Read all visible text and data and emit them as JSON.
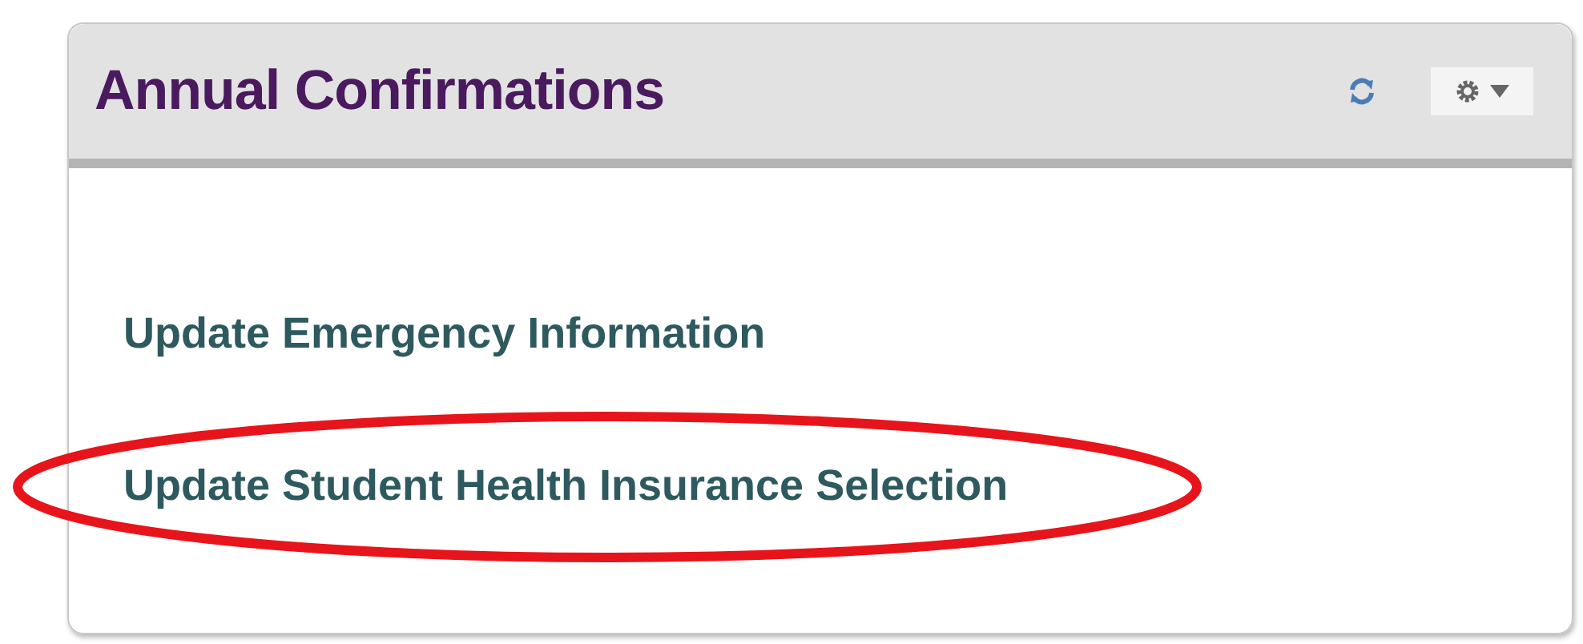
{
  "panel": {
    "title": "Annual Confirmations"
  },
  "links": [
    {
      "label": "Update Emergency Information",
      "circled": false
    },
    {
      "label": "Update Student Health Insurance Selection",
      "circled": true
    }
  ]
}
